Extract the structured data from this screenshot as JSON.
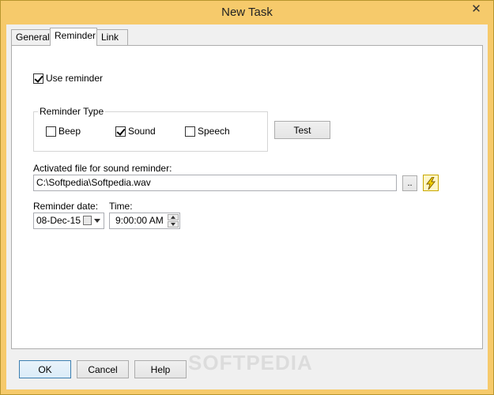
{
  "window": {
    "title": "New Task",
    "close_glyph": "✕"
  },
  "tabs": [
    {
      "label": "General"
    },
    {
      "label": "Reminder"
    },
    {
      "label": "Link"
    }
  ],
  "reminder": {
    "use_reminder_label": "Use reminder",
    "use_reminder_checked": true,
    "type_group_label": "Reminder Type",
    "types": [
      {
        "label": "Beep",
        "checked": false
      },
      {
        "label": "Sound",
        "checked": true
      },
      {
        "label": "Speech",
        "checked": false
      }
    ],
    "test_label": "Test",
    "file_label": "Activated file for sound reminder:",
    "file_value": "C:\\Softpedia\\Softpedia.wav",
    "browse_label": "..",
    "date_label": "Reminder date:",
    "date_value": "08-Dec-15",
    "time_label": "Time:",
    "time_value": "9:00:00 AM"
  },
  "buttons": {
    "ok": "OK",
    "cancel": "Cancel",
    "help": "Help"
  },
  "watermark": "SOFTPEDIA"
}
